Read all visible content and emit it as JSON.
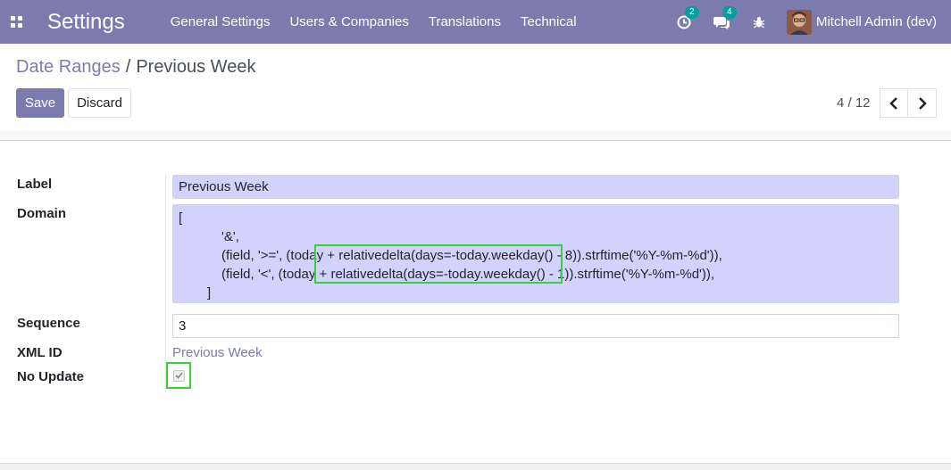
{
  "navbar": {
    "brand": "Settings",
    "menu": [
      "General Settings",
      "Users & Companies",
      "Translations",
      "Technical"
    ],
    "activity_count": "2",
    "messages_count": "4",
    "user_name": "Mitchell Admin (dev)"
  },
  "breadcrumb": {
    "parent": "Date Ranges",
    "separator": "/",
    "current": "Previous Week"
  },
  "buttons": {
    "save": "Save",
    "discard": "Discard"
  },
  "pager": {
    "value": "4 / 12"
  },
  "form": {
    "label_label": "Label",
    "label_value": "Previous Week",
    "domain_label": "Domain",
    "domain_lines": [
      "[",
      "'&',",
      "(field, '>=', (today + relativedelta(days=-today.weekday() - 8)).strftime('%Y-%m-%d')),",
      "(field, '<', (today + relativedelta(days=-today.weekday() - 1)).strftime('%Y-%m-%d')),",
      "]"
    ],
    "sequence_label": "Sequence",
    "sequence_value": "3",
    "xmlid_label": "XML ID",
    "xmlid_value": "Previous Week",
    "noupdate_label": "No Update",
    "noupdate_checked": true
  },
  "colors": {
    "brand": "#7c7bad",
    "badge": "#00a09d",
    "highlight": "#3ad03a",
    "field_bg": "#d2d2ff"
  }
}
